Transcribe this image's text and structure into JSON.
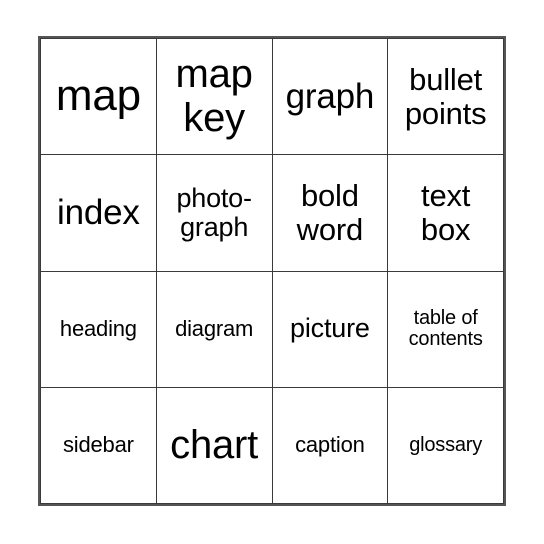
{
  "card": {
    "type": "bingo-card",
    "rows": 4,
    "columns": 4,
    "border_color": "#555555",
    "grid_line_color": "#3a3a3a",
    "background_color": "#ffffff",
    "text_color": "#000000",
    "cells": [
      [
        {
          "text": "map",
          "size": "fs-xxl",
          "lines": 1
        },
        {
          "text": "map\nkey",
          "size": "fs-xl",
          "lines": 2
        },
        {
          "text": "graph",
          "size": "fs-l",
          "lines": 1
        },
        {
          "text": "bullet\npoints",
          "size": "fs-m",
          "lines": 2
        }
      ],
      [
        {
          "text": "index",
          "size": "fs-l",
          "lines": 1
        },
        {
          "text": "photo-\ngraph",
          "size": "fs-s",
          "lines": 2
        },
        {
          "text": "bold\nword",
          "size": "fs-m",
          "lines": 2
        },
        {
          "text": "text\nbox",
          "size": "fs-m",
          "lines": 2
        }
      ],
      [
        {
          "text": "heading",
          "size": "fs-xs",
          "lines": 1
        },
        {
          "text": "diagram",
          "size": "fs-xs",
          "lines": 1
        },
        {
          "text": "picture",
          "size": "fs-s",
          "lines": 1
        },
        {
          "text": "table of\ncontents",
          "size": "fs-xxs",
          "lines": 2
        }
      ],
      [
        {
          "text": "sidebar",
          "size": "fs-xs",
          "lines": 1
        },
        {
          "text": "chart",
          "size": "fs-xl",
          "lines": 1
        },
        {
          "text": "caption",
          "size": "fs-xs",
          "lines": 1
        },
        {
          "text": "glossary",
          "size": "fs-xxs",
          "lines": 1
        }
      ]
    ]
  }
}
